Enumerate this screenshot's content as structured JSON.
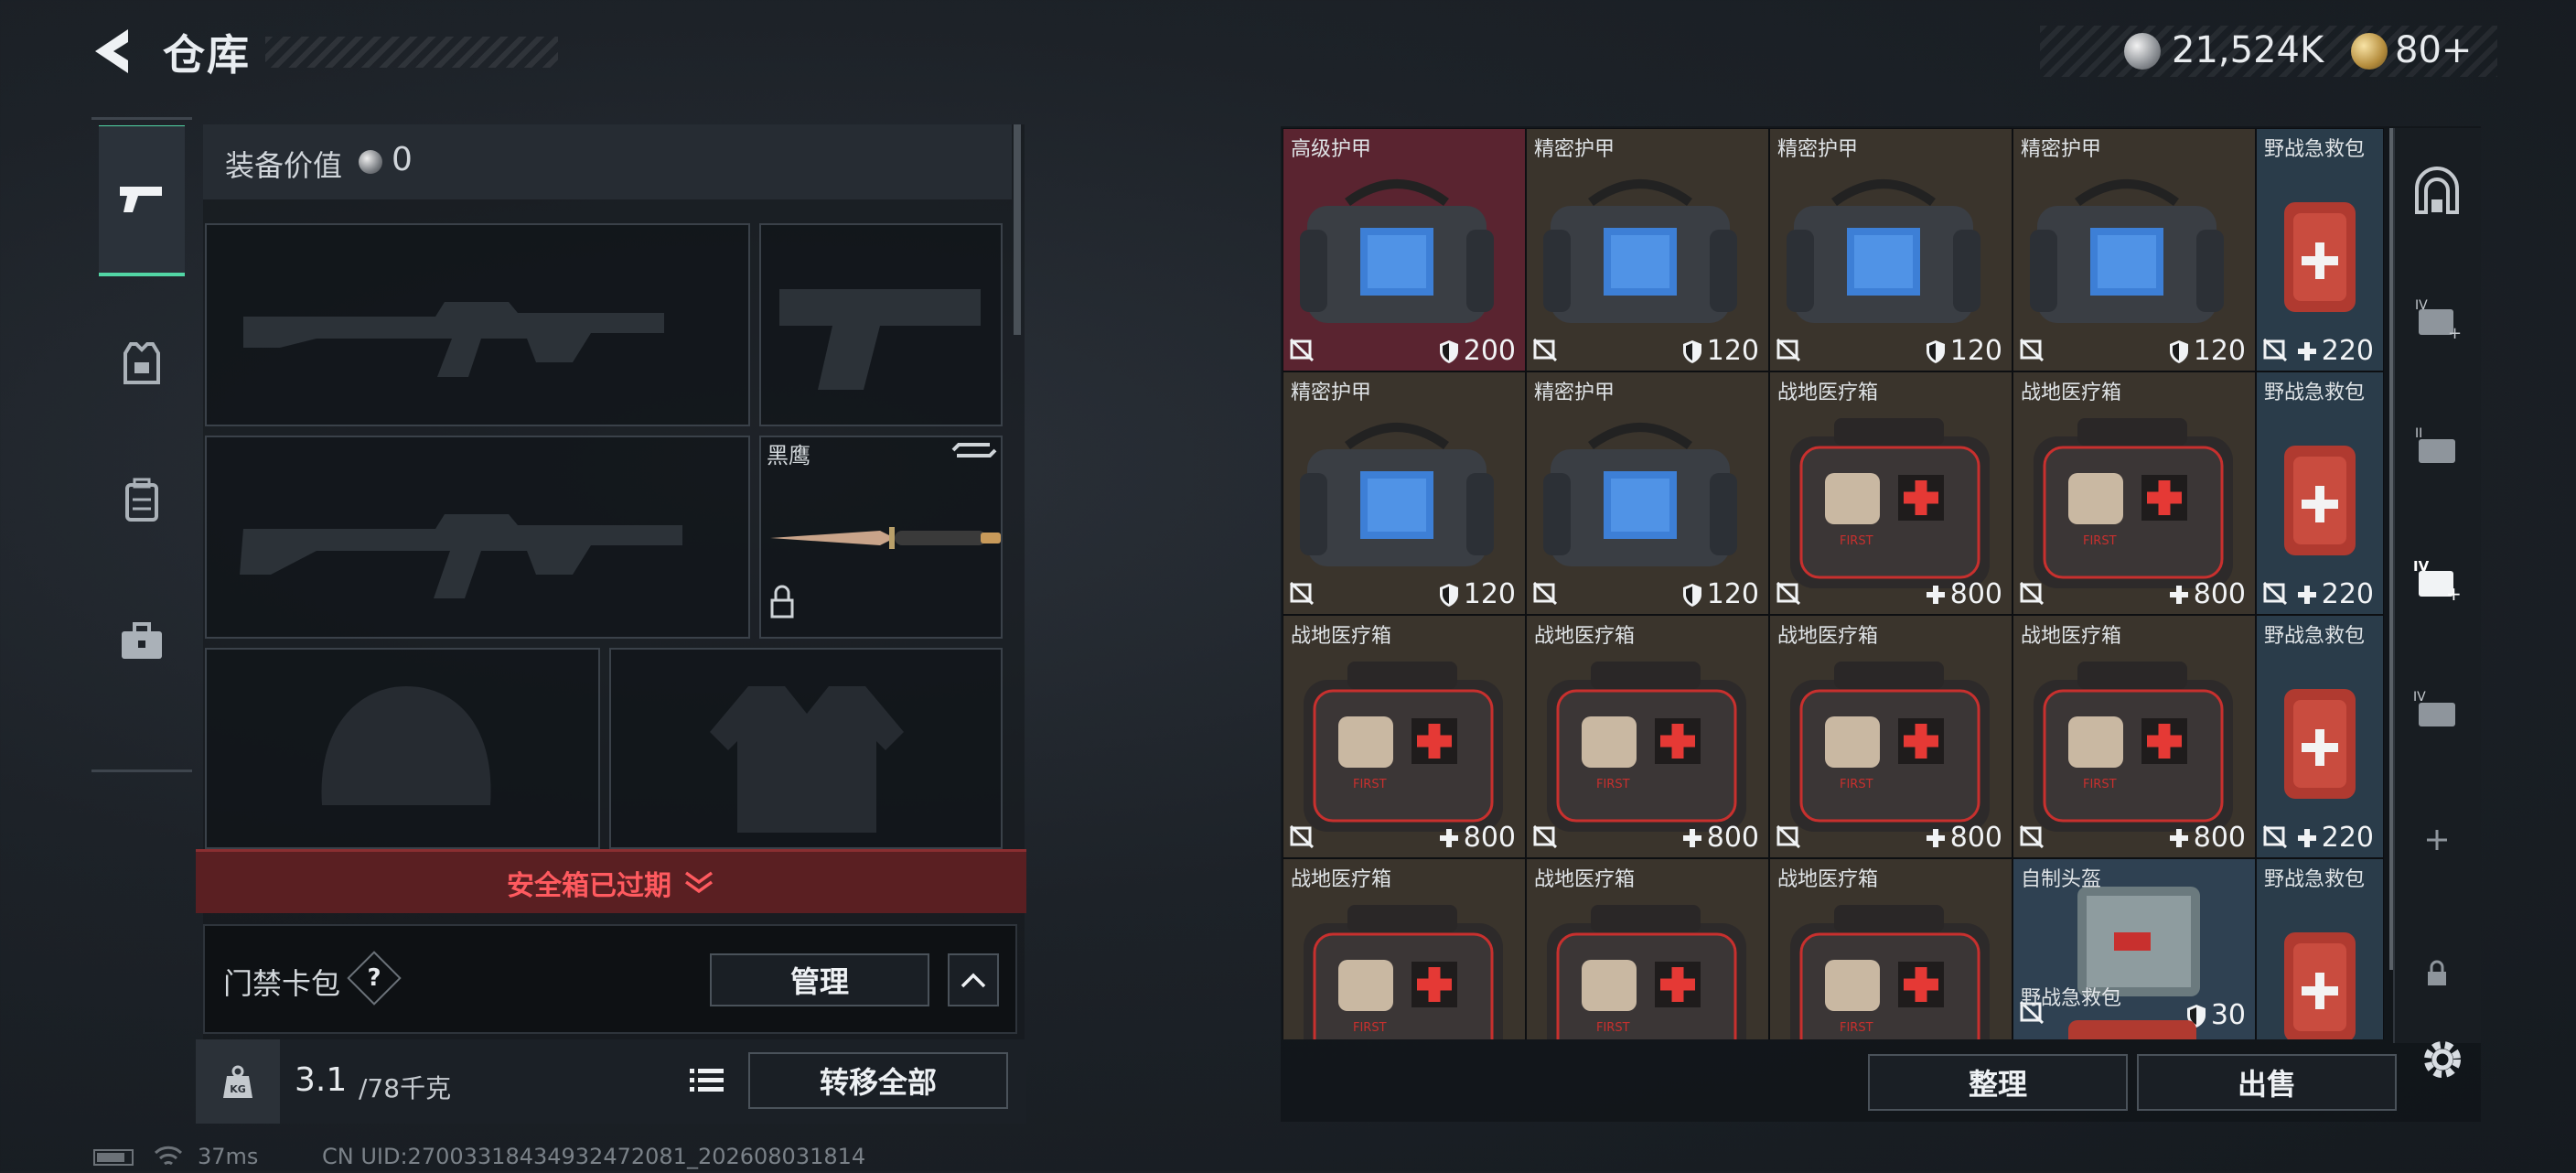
{
  "header": {
    "title": "仓库",
    "money": "21,524K",
    "gold": "80+"
  },
  "equipment": {
    "value_label": "装备价值",
    "value": "0",
    "melee_name": "黑鹰",
    "safe_box_status": "安全箱已过期",
    "access_card_label": "门禁卡包",
    "help": "?",
    "manage_label": "管理",
    "weight_current": "3.1",
    "weight_max": "/78千克",
    "transfer_all_label": "转移全部"
  },
  "status": {
    "ping": "37ms",
    "uid": "CN UID:27003318434932472081_202608031814"
  },
  "stash": {
    "cells": [
      {
        "name": "高级护甲",
        "value": "200",
        "kind": "armor",
        "stat": "shield"
      },
      {
        "name": "精密护甲",
        "value": "120",
        "kind": "armor",
        "stat": "shield"
      },
      {
        "name": "精密护甲",
        "value": "120",
        "kind": "armor",
        "stat": "shield"
      },
      {
        "name": "精密护甲",
        "value": "120",
        "kind": "armor",
        "stat": "shield"
      },
      {
        "name": "野战急救包",
        "value": "220",
        "kind": "kit",
        "stat": "plus"
      },
      {
        "name": "精密护甲",
        "value": "120",
        "kind": "armor",
        "stat": "shield"
      },
      {
        "name": "精密护甲",
        "value": "120",
        "kind": "armor",
        "stat": "shield"
      },
      {
        "name": "战地医疗箱",
        "value": "800",
        "kind": "medbox",
        "stat": "plus"
      },
      {
        "name": "战地医疗箱",
        "value": "800",
        "kind": "medbox",
        "stat": "plus"
      },
      {
        "name": "野战急救包",
        "value": "220",
        "kind": "kit",
        "stat": "plus"
      },
      {
        "name": "战地医疗箱",
        "value": "800",
        "kind": "medbox",
        "stat": "plus"
      },
      {
        "name": "战地医疗箱",
        "value": "800",
        "kind": "medbox",
        "stat": "plus"
      },
      {
        "name": "战地医疗箱",
        "value": "800",
        "kind": "medbox",
        "stat": "plus"
      },
      {
        "name": "战地医疗箱",
        "value": "800",
        "kind": "medbox",
        "stat": "plus"
      },
      {
        "name": "野战急救包",
        "value": "220",
        "kind": "kit",
        "stat": "plus"
      },
      {
        "name": "战地医疗箱",
        "value": "",
        "kind": "medbox",
        "stat": "none"
      },
      {
        "name": "战地医疗箱",
        "value": "",
        "kind": "medbox",
        "stat": "none"
      },
      {
        "name": "战地医疗箱",
        "value": "",
        "kind": "medbox",
        "stat": "none"
      },
      {
        "name": "自制头盔",
        "value": "30",
        "kind": "helmet",
        "stat": "shield"
      },
      {
        "name": "野战急救包",
        "value": "",
        "kind": "kit",
        "stat": "none"
      }
    ],
    "sub_label": "野战急救包",
    "sort_label": "整理",
    "sell_label": "出售"
  },
  "colors": {
    "accent": "#52d6a5",
    "danger": "#ff5a5f",
    "armor_highlight": "#5a2430",
    "kit_bg": "#2a3c4a",
    "cell_bg": "#3a342c"
  }
}
